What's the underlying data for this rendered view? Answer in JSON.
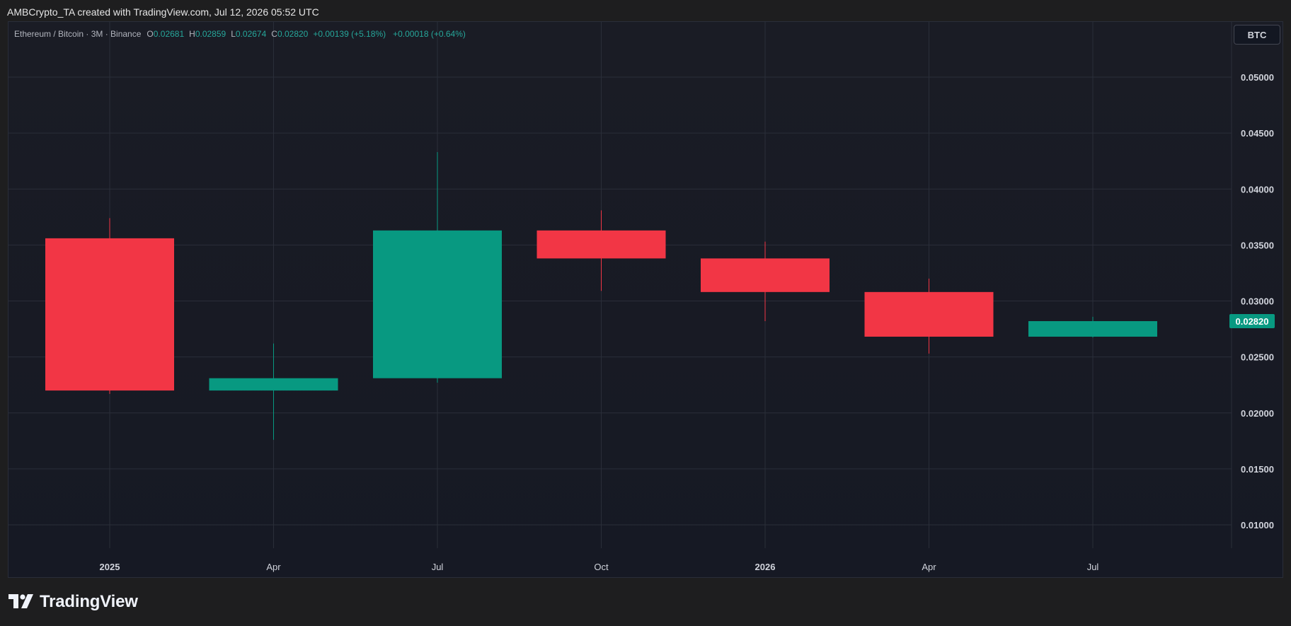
{
  "header": {
    "caption": "AMBCrypto_TA created with TradingView.com, Jul 12, 2026 05:52 UTC"
  },
  "legend": {
    "symbol": "Ethereum / Bitcoin · 3M · Binance",
    "open_label": "O",
    "open_value": "0.02681",
    "high_label": "H",
    "high_value": "0.02859",
    "low_label": "L",
    "low_value": "0.02674",
    "close_label": "C",
    "close_value": "0.02820",
    "change_abs": "+0.00139 (+5.18%)",
    "change_last": "+0.00018 (+0.64%)"
  },
  "currency_button": "BTC",
  "brand": "TradingView",
  "colors": {
    "up": "#089981",
    "down": "#f23645",
    "grid": "#2a2e39",
    "price_tag": "#089981"
  },
  "chart_data": {
    "type": "candlestick",
    "interval": "3M",
    "y_axis_side": "right",
    "ylim": [
      0.0065,
      0.0555
    ],
    "yticks": [
      "0.05000",
      "0.04500",
      "0.04000",
      "0.03500",
      "0.03000",
      "0.02500",
      "0.02000",
      "0.01500",
      "0.01000"
    ],
    "xticks": [
      {
        "label": "2025",
        "bold": true,
        "index": 0
      },
      {
        "label": "Apr",
        "bold": false,
        "index": 1
      },
      {
        "label": "Jul",
        "bold": false,
        "index": 2
      },
      {
        "label": "Oct",
        "bold": false,
        "index": 3
      },
      {
        "label": "2026",
        "bold": true,
        "index": 4
      },
      {
        "label": "Apr",
        "bold": false,
        "index": 5
      },
      {
        "label": "Jul",
        "bold": false,
        "index": 6
      }
    ],
    "candles": [
      {
        "period": "2025 Q1",
        "open": 0.0356,
        "high": 0.0374,
        "low": 0.0217,
        "close": 0.022
      },
      {
        "period": "2025 Q2",
        "open": 0.022,
        "high": 0.0262,
        "low": 0.0176,
        "close": 0.0231
      },
      {
        "period": "2025 Q3",
        "open": 0.0231,
        "high": 0.0433,
        "low": 0.0227,
        "close": 0.0363
      },
      {
        "period": "2025 Q4",
        "open": 0.0363,
        "high": 0.0381,
        "low": 0.0309,
        "close": 0.0338
      },
      {
        "period": "2026 Q1",
        "open": 0.0338,
        "high": 0.0353,
        "low": 0.0282,
        "close": 0.0308
      },
      {
        "period": "2026 Q2",
        "open": 0.0308,
        "high": 0.032,
        "low": 0.0253,
        "close": 0.02681
      },
      {
        "period": "2026 Q3",
        "open": 0.02681,
        "high": 0.02859,
        "low": 0.02674,
        "close": 0.0282
      }
    ],
    "last_price_label": "0.02820"
  }
}
